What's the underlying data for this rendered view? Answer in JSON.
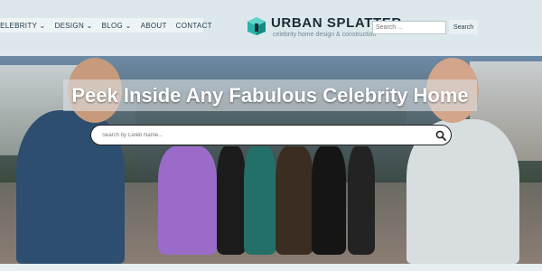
{
  "nav": {
    "items": [
      {
        "label": "CELEBRITY",
        "has_dropdown": true
      },
      {
        "label": "DESIGN",
        "has_dropdown": true
      },
      {
        "label": "BLOG",
        "has_dropdown": true
      },
      {
        "label": "ABOUT",
        "has_dropdown": false
      },
      {
        "label": "CONTACT",
        "has_dropdown": false
      }
    ],
    "dropdown_glyph": "⌄"
  },
  "logo": {
    "title": "URBAN SPLATTER",
    "tagline": "celebrity home design & construction",
    "icon": "cube-logo-icon",
    "color": "#26b3a8"
  },
  "header_search": {
    "placeholder": "Search ...",
    "value": "",
    "button_label": "Search"
  },
  "hero": {
    "title": "Peek Inside Any Fabulous Celebrity Home",
    "search_placeholder": "Search by Celeb Name...",
    "search_icon": "magnifier-icon"
  },
  "colors": {
    "header_bg": "#dde8ec",
    "nav_bg": "#eef3f6",
    "accent": "#26b3a8"
  }
}
